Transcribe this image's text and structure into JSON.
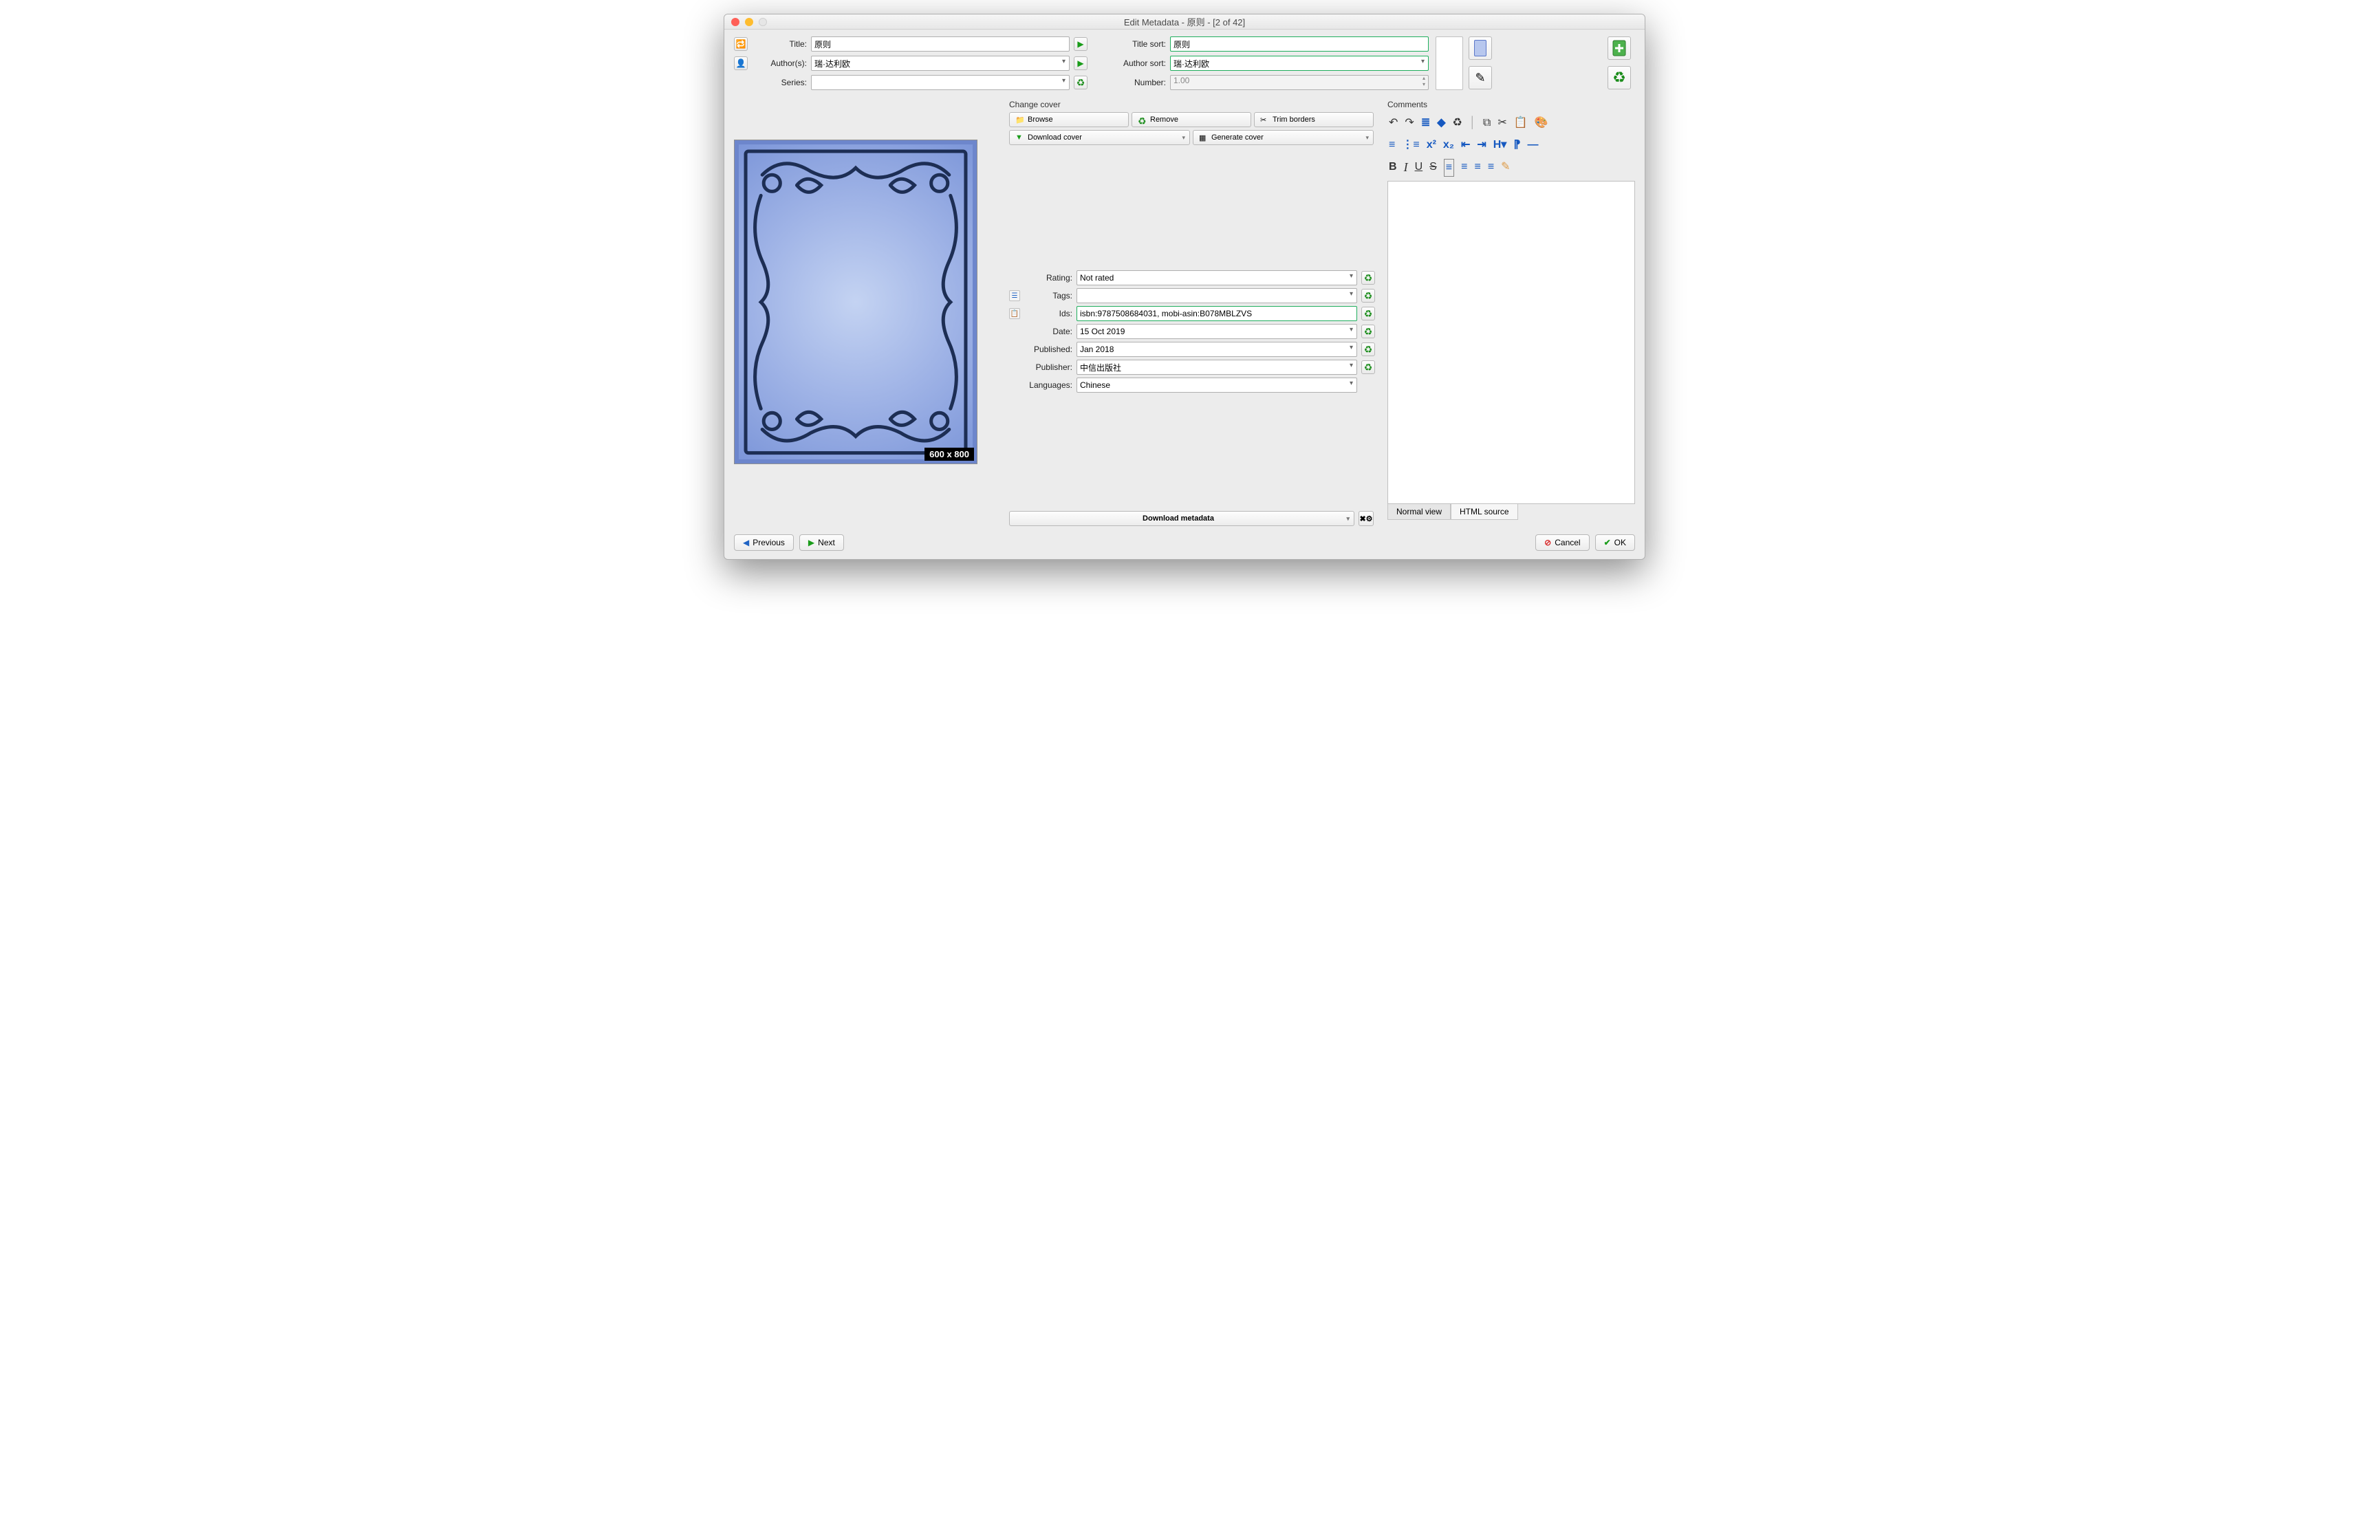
{
  "window": {
    "title": "Edit Metadata - 原则 -  [2 of 42]"
  },
  "labels": {
    "title": "Title:",
    "title_sort": "Title sort:",
    "authors": "Author(s):",
    "author_sort": "Author sort:",
    "series": "Series:",
    "number": "Number:",
    "change_cover": "Change cover",
    "rating": "Rating:",
    "tags": "Tags:",
    "ids": "Ids:",
    "date": "Date:",
    "published": "Published:",
    "publisher": "Publisher:",
    "languages": "Languages:",
    "comments": "Comments"
  },
  "fields": {
    "title": "原则",
    "title_sort": "原则",
    "authors": "瑞·达利欧",
    "author_sort": "瑞·达利欧",
    "series": "",
    "number": "1.00",
    "rating": "Not rated",
    "tags": "",
    "ids": "isbn:9787508684031, mobi-asin:B078MBLZVS",
    "date": "15 Oct 2019",
    "published": "Jan 2018",
    "publisher": "中信出版社",
    "languages": "Chinese"
  },
  "cover": {
    "dimensions": "600 x 800"
  },
  "cover_buttons": {
    "browse": "Browse",
    "remove": "Remove",
    "trim": "Trim borders",
    "download": "Download cover",
    "generate": "Generate cover"
  },
  "download_metadata": "Download metadata",
  "tabs": {
    "normal": "Normal view",
    "html": "HTML source"
  },
  "nav": {
    "prev": "Previous",
    "next": "Next",
    "cancel": "Cancel",
    "ok": "OK"
  }
}
